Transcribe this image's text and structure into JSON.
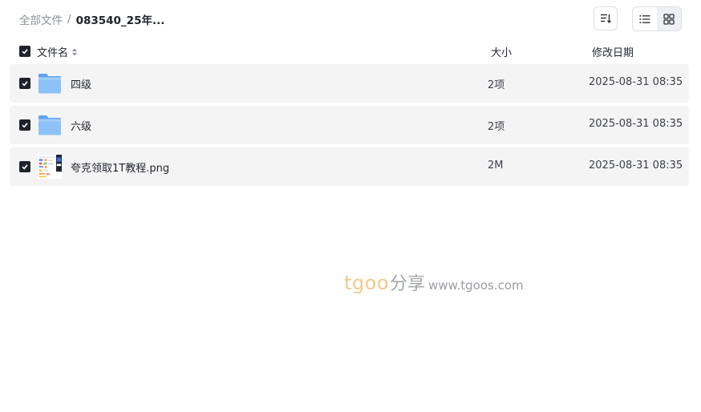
{
  "breadcrumb": {
    "root": "全部文件",
    "separator": "/",
    "current": "083540_25年..."
  },
  "toolbar": {
    "sort_icon": "sort-icon",
    "list_view_icon": "list-view-icon",
    "grid_view_icon": "grid-view-icon"
  },
  "table": {
    "headers": {
      "name": "文件名",
      "size": "大小",
      "date": "修改日期"
    },
    "rows": [
      {
        "name": "四级",
        "size": "2项",
        "date": "2025-08-31 08:35",
        "type": "folder",
        "checked": true
      },
      {
        "name": "六级",
        "size": "2项",
        "date": "2025-08-31 08:35",
        "type": "folder",
        "checked": true
      },
      {
        "name": "夸克领取1T教程.png",
        "size": "2M",
        "date": "2025-08-31 08:35",
        "type": "image",
        "checked": true
      }
    ]
  },
  "watermark": {
    "brand": "tgoo",
    "share": "分享",
    "url": "www.tgoos.com"
  },
  "colors": {
    "row_bg": "#f4f4f5",
    "checkbox": "#1f2329",
    "folder": "#7fb8f5",
    "watermark_brand": "#f4c98a"
  }
}
